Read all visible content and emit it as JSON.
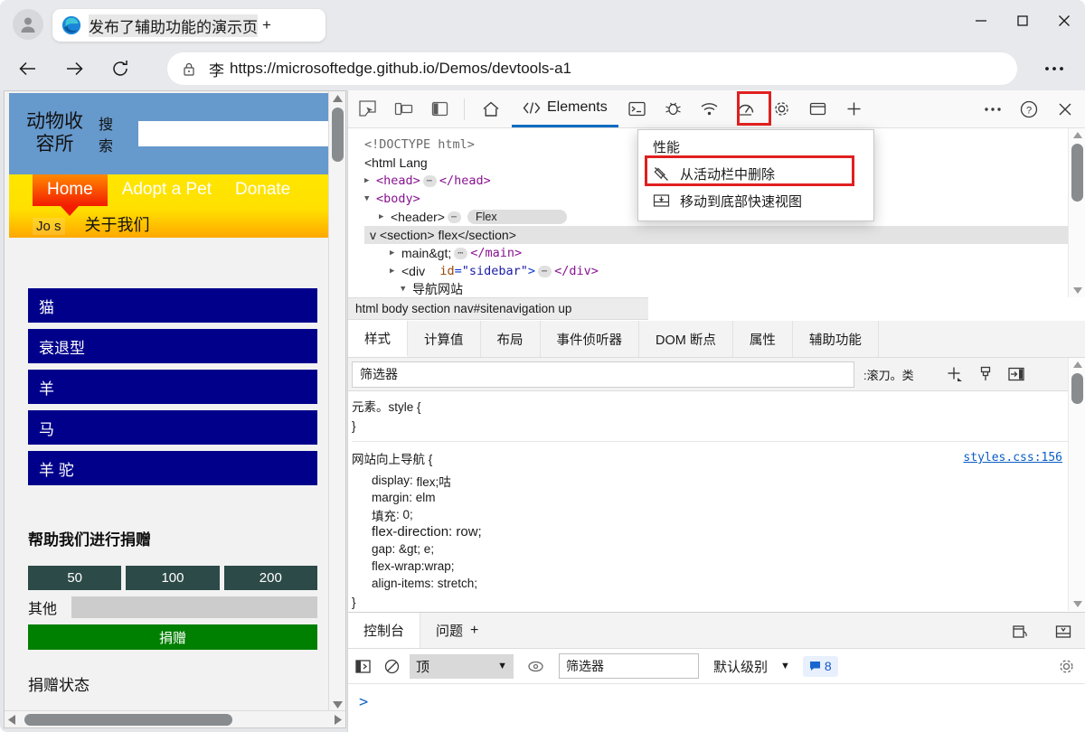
{
  "browser": {
    "tab": {
      "title": "发布了辅助功能的演示页",
      "plus": "+",
      "favicon": "edge-logo-icon"
    },
    "window_controls": {
      "minimize": "minimize-icon",
      "maximize": "maximize-icon",
      "close": "close-icon"
    },
    "nav": {
      "back": "back-arrow-icon",
      "forward": "forward-arrow-icon",
      "reload": "reload-icon"
    },
    "omnibox": {
      "lock": "lock-icon",
      "prefix": "李",
      "url": "https://microsoftedge.github.io/Demos/devtools-a1",
      "more": "ellipsis-icon"
    },
    "settings_more": "ellipsis-icon"
  },
  "page": {
    "header": {
      "logo": "动物收\n容所",
      "logo_line1": "动物收",
      "logo_line2": "容所",
      "search_label": "搜索",
      "search_value": "",
      "bg": "#6699cc"
    },
    "nav": {
      "primary": [
        {
          "label": "Home",
          "active": true
        },
        {
          "label": "Adopt a Pet",
          "active": false
        },
        {
          "label": "Donate",
          "active": false
        }
      ],
      "secondary": [
        {
          "label": "Jo s"
        },
        {
          "label": "关于我们"
        }
      ]
    },
    "animals": [
      {
        "label": "猫"
      },
      {
        "label": "衰退型"
      },
      {
        "label": "羊"
      },
      {
        "label": "马"
      },
      {
        "label": "羊 驼"
      }
    ],
    "donation": {
      "title": "帮助我们进行捐赠",
      "amounts": [
        "50",
        "100",
        "200"
      ],
      "other_label": "其他",
      "other_value": "",
      "submit_label": "捐赠",
      "status_title": "捐赠状态"
    }
  },
  "devtools": {
    "toolbar": {
      "icons": [
        "inspect-element-icon",
        "device-emulation-icon",
        "dock-side-icon"
      ],
      "home_icon": "home-icon",
      "tabs": [
        {
          "label": "Elements",
          "icon": "code-brackets-icon",
          "active": true
        }
      ],
      "more_tabs": [
        "console-icon",
        "sources-debug-icon",
        "network-icon",
        "performance-icon",
        "settings-gear-icon",
        "application-icon",
        "add-panel-icon"
      ],
      "right": [
        "more-icon",
        "help-icon",
        "close-icon"
      ]
    },
    "popup": {
      "title": "性能",
      "items": [
        {
          "label": "从活动栏中删除",
          "icon": "unpin-icon",
          "highlighted": true
        },
        {
          "label": "移动到底部快速视图",
          "icon": "move-to-drawer-icon",
          "highlighted": false
        }
      ]
    },
    "dom": {
      "lines": [
        {
          "type": "doctype",
          "text": "<!DOCTYPE html>"
        },
        {
          "type": "plain",
          "text": "<html Lang"
        },
        {
          "type": "head",
          "open": "<head>",
          "close": "</head>"
        },
        {
          "type": "body",
          "text": "<body>"
        },
        {
          "type": "header",
          "tag": "<header>",
          "badge": "Flex"
        },
        {
          "type": "section",
          "text": "v <section> flex</section>",
          "selected": true
        },
        {
          "type": "main",
          "text": "main&gt;",
          "close": "</main>"
        },
        {
          "type": "div",
          "tag": "<div",
          "attr": "id",
          "value": "\"sidebar\"",
          "close": "</div>"
        },
        {
          "type": "nav",
          "text": "导航网站"
        }
      ]
    },
    "breadcrumb": "html body section nav#sitenavigation up",
    "styles_tabs": [
      {
        "label": "样式",
        "active": true
      },
      {
        "label": "计算值",
        "active": false
      },
      {
        "label": "布局",
        "active": false
      },
      {
        "label": "事件侦听器",
        "active": false
      },
      {
        "label": "DOM 断点",
        "active": false
      },
      {
        "label": "属性",
        "active": false
      },
      {
        "label": "辅助功能",
        "active": false
      }
    ],
    "filter": {
      "placeholder": "筛选器",
      "value": "",
      "cls_label": ":滚刀。类",
      "icons": [
        "add-rule-icon",
        "style-brush-icon",
        "toggle-pane-icon"
      ]
    },
    "styles": {
      "element_rule": {
        "selector": "元素。style {",
        "close": "}"
      },
      "rules": [
        {
          "selector": "网站向上导航 {",
          "source": "styles.css:156",
          "declarations": [
            {
              "name": "display",
              "value": "flex;咕"
            },
            {
              "name": "margin",
              "value": "elm"
            },
            {
              "name": "填充",
              "value": "0;"
            },
            {
              "name": "flex-direction",
              "value": "row;"
            },
            {
              "name": "gap",
              "value": "&gt; e;"
            },
            {
              "name": "flex-wrap",
              "value": "wrap;"
            },
            {
              "name": "align-items",
              "value": "stretch;"
            }
          ],
          "close": "}"
        }
      ]
    },
    "console": {
      "tabs": [
        {
          "label": "控制台",
          "active": true
        },
        {
          "label": "问题",
          "active": false
        }
      ],
      "tabs_plus": "+",
      "tab_right_icons": [
        "restore-drawer-icon",
        "dock-drawer-icon"
      ],
      "toolbar": {
        "sidebar_icon": "console-sidebar-icon",
        "clear_icon": "clear-console-icon",
        "context": "顶",
        "context_caret": "▼",
        "eye_icon": "live-expression-icon",
        "filter_placeholder": "筛选器",
        "filter_value": "",
        "level": "默认级别",
        "level_caret": "▼",
        "message_count": "8",
        "message_icon": "message-bubble-icon",
        "settings_icon": "settings-gear-icon"
      },
      "prompt": ">"
    }
  },
  "colors": {
    "accent_blue": "#0a6cc1",
    "highlight_red": "#e02020",
    "site_header_blue": "#6699cc",
    "nav_yellow": "#ffe600",
    "nav_home_red": "#f31b00",
    "animal_navy": "#00008b",
    "donate_green": "#008000",
    "amount_dark": "#2c4a47"
  }
}
